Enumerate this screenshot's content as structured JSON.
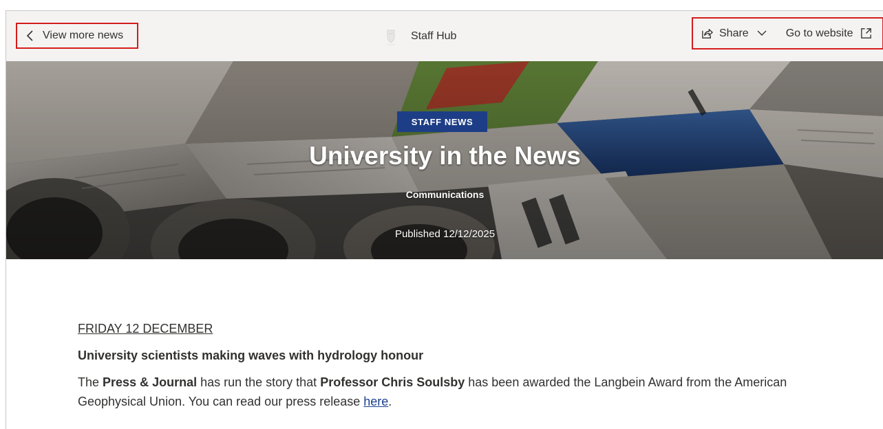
{
  "header": {
    "back_label": "View more news",
    "hub_name": "Staff Hub",
    "share_label": "Share",
    "website_label": "Go to website"
  },
  "hero": {
    "tag": "STAFF NEWS",
    "title": "University in the News",
    "author": "Communications",
    "published": "Published 12/12/2025"
  },
  "article": {
    "day_heading": "FRIDAY 12 DECEMBER",
    "headline": "University scientists making waves with hydrology honour",
    "para_1": "The ",
    "para_outlet": "Press & Journal",
    "para_2": " has run the story that ",
    "para_person": "Professor Chris Soulsby",
    "para_3": " has been awarded the Langbein Award from the American Geophysical Union. You can read our press release ",
    "para_link": "here",
    "para_4": "."
  },
  "colors": {
    "highlight_border": "#d41b1b",
    "tag_background": "#1d3e86",
    "link": "#1a3f8e",
    "header_background": "#f4f3f2"
  },
  "icons": {
    "back": "chevron-left-icon",
    "share": "share-icon",
    "dropdown": "chevron-down-icon",
    "external": "external-link-icon",
    "logo": "university-crest-icon"
  }
}
